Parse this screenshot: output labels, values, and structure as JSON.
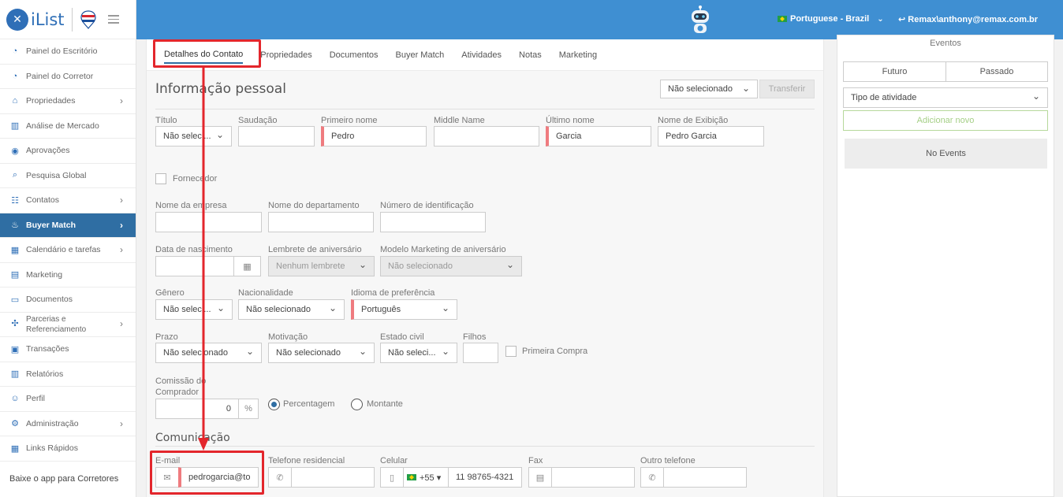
{
  "brand": {
    "name": "iList",
    "logo_letter": "✕"
  },
  "sidebar": {
    "items": [
      {
        "label": "Painel do Escritório",
        "icon": "gauge-icon",
        "glyph": "◔"
      },
      {
        "label": "Painel do Corretor",
        "icon": "gauge-icon",
        "glyph": "◔"
      },
      {
        "label": "Propriedades",
        "icon": "home-icon",
        "glyph": "⌂",
        "chevron": "›"
      },
      {
        "label": "Análise de Mercado",
        "icon": "bar-chart-icon",
        "glyph": "▥"
      },
      {
        "label": "Aprovações",
        "icon": "eye-icon",
        "glyph": "◉"
      },
      {
        "label": "Pesquisa Global",
        "icon": "search-icon",
        "glyph": "⌕"
      },
      {
        "label": "Contatos",
        "icon": "contacts-icon",
        "glyph": "☷",
        "chevron": "›"
      },
      {
        "label": "Buyer Match",
        "icon": "flame-icon",
        "glyph": "♨",
        "chevron": "›"
      },
      {
        "label": "Calendário e tarefas",
        "icon": "calendar-icon",
        "glyph": "▦",
        "chevron": "›"
      },
      {
        "label": "Marketing",
        "icon": "newspaper-icon",
        "glyph": "▤"
      },
      {
        "label": "Documentos",
        "icon": "folder-icon",
        "glyph": "▭"
      },
      {
        "label": "Parcerias e Referenciamento",
        "icon": "handshake-icon",
        "glyph": "✣",
        "chevron": "›"
      },
      {
        "label": "Transações",
        "icon": "briefcase-icon",
        "glyph": "▣"
      },
      {
        "label": "Relatórios",
        "icon": "report-icon",
        "glyph": "▥"
      },
      {
        "label": "Perfil",
        "icon": "user-icon",
        "glyph": "☺"
      },
      {
        "label": "Administração",
        "icon": "gear-icon",
        "glyph": "⚙",
        "chevron": "›"
      },
      {
        "label": "Links Rápidos",
        "icon": "links-icon",
        "glyph": "▦"
      }
    ],
    "footer": "Baixe o app para Corretores"
  },
  "topbar": {
    "language": "Portuguese - Brazil",
    "user": "Remax\\anthony@remax.com.br",
    "user_icon": "reply-icon"
  },
  "tabs": [
    "Detalhes do Contato",
    "Propriedades",
    "Documentos",
    "Buyer Match",
    "Atividades",
    "Notas",
    "Marketing"
  ],
  "personal": {
    "title": "Informação pessoal",
    "assign_select": "Não selecionado",
    "transfer_button": "Transferir",
    "labels": {
      "titulo": "Título",
      "saudacao": "Saudação",
      "primeiro": "Primeiro nome",
      "middle": "Middle Name",
      "ultimo": "Último nome",
      "exibicao": "Nome de Exibição",
      "fornecedor": "Fornecedor",
      "empresa": "Nome da empresa",
      "departamento": "Nome do departamento",
      "identificacao": "Número de identificação",
      "nascimento": "Data de nascimento",
      "lembrete": "Lembrete de aniversário",
      "modelo": "Modelo Marketing de aniversário",
      "genero": "Gênero",
      "nacionalidade": "Nacionalidade",
      "idioma": "Idioma de preferência",
      "prazo": "Prazo",
      "motivacao": "Motivação",
      "civil": "Estado civil",
      "filhos": "Filhos",
      "primeira": "Primeira Compra",
      "comissao": "Comissão do Comprador",
      "percentagem": "Percentagem",
      "montante": "Montante"
    },
    "values": {
      "titulo": "Não seleci...",
      "primeiro": "Pedro",
      "ultimo": "Garcia",
      "exibicao": "Pedro Garcia",
      "lembrete": "Nenhum lembrete",
      "modelo": "Não selecionado",
      "genero": "Não seleci...",
      "nacionalidade": "Não selecionado",
      "idioma": "Português",
      "prazo": "Não selecionado",
      "motivacao": "Não selecionado",
      "civil": "Não seleci...",
      "comissao": "0",
      "comissao_unit": "%"
    }
  },
  "communication": {
    "title": "Comunicação",
    "labels": {
      "email": "E-mail",
      "residencial": "Telefone residencial",
      "celular": "Celular",
      "fax": "Fax",
      "outro": "Outro telefone"
    },
    "values": {
      "email": "pedrogarcia@to",
      "country_code": "+55 ▾",
      "celular": "11 98765-4321"
    }
  },
  "events": {
    "title": "Eventos",
    "future": "Futuro",
    "past": "Passado",
    "type_select": "Tipo de atividade",
    "add_button": "Adicionar novo",
    "empty": "No Events"
  },
  "colors": {
    "accent": "#2f6ea3",
    "topbar": "#3f8fd2",
    "highlight": "#e3262c",
    "required": "#ef7b7f"
  }
}
